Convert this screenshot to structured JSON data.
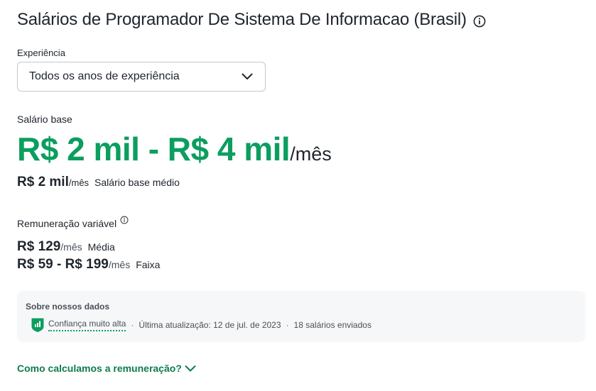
{
  "header": {
    "title": "Salários de Programador De Sistema De Informacao (Brasil)",
    "info_icon": "info-circle-icon"
  },
  "experience": {
    "label": "Experiência",
    "selected": "Todos os anos de experiência",
    "chevron_icon": "chevron-down-icon"
  },
  "base_salary": {
    "label": "Salário base",
    "range": "R$ 2 mil - R$ 4 mil",
    "range_unit": "/mês",
    "average_value": "R$ 2 mil",
    "average_unit": "/mês",
    "average_label": "Salário base médio"
  },
  "variable_pay": {
    "label": "Remuneração variável",
    "info_icon": "info-circle-icon",
    "average_value": "R$ 129",
    "average_unit": "/mês",
    "average_label": "Média",
    "range_value": "R$ 59 - R$ 199",
    "range_unit": "/mês",
    "range_label": "Faixa"
  },
  "data_info": {
    "title": "Sobre nossos dados",
    "confidence_icon": "shield-bars-icon",
    "confidence": "Confiança muito alta",
    "separator": "·",
    "last_update": "Última atualização: 12 de jul. de 2023",
    "count": "18 salários enviados"
  },
  "calc_link": {
    "label": "Como calculamos a remuneração?",
    "chevron_icon": "chevron-down-icon"
  },
  "colors": {
    "accent_green": "#0c9e5f",
    "link_green": "#0d7d4c",
    "text": "#20262e",
    "panel_bg": "#f6f7f8"
  }
}
